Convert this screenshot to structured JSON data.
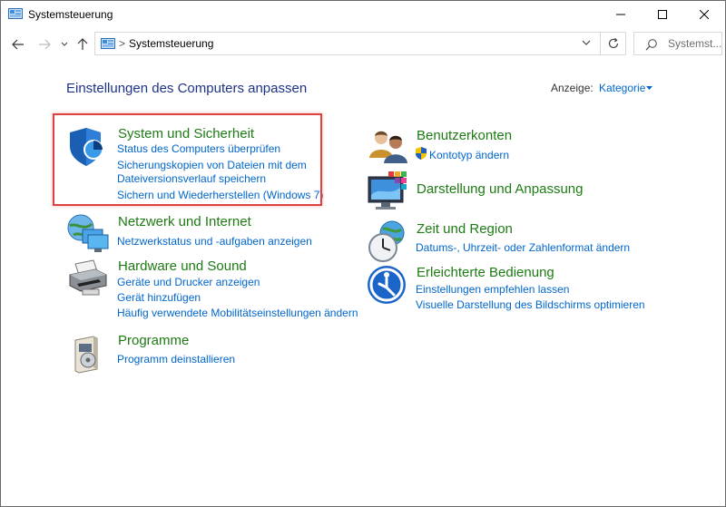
{
  "window": {
    "title": "Systemsteuerung"
  },
  "address": {
    "path": "Systemsteuerung",
    "separator": ">"
  },
  "search": {
    "placeholder": "Systemst..."
  },
  "header": {
    "heading": "Einstellungen des Computers anpassen",
    "view_label": "Anzeige:",
    "view_value": "Kategorie"
  },
  "categories": [
    {
      "title": "System und Sicherheit",
      "icon": "shield-icon",
      "links": [
        "Status des Computers überprüfen",
        "Sicherungskopien von Dateien mit dem",
        "Dateiversionsverlauf speichern",
        "Sichern und Wiederherstellen (Windows 7)"
      ]
    },
    {
      "title": "Netzwerk und Internet",
      "icon": "network-globe-icon",
      "links": [
        "Netzwerkstatus und -aufgaben anzeigen"
      ]
    },
    {
      "title": "Hardware und Sound",
      "icon": "printer-icon",
      "links": [
        "Geräte und Drucker anzeigen",
        "Gerät hinzufügen",
        "Häufig verwendete Mobilitätseinstellungen ändern"
      ]
    },
    {
      "title": "Programme",
      "icon": "programs-box-icon",
      "links": [
        "Programm deinstallieren"
      ]
    },
    {
      "title": "Benutzerkonten",
      "icon": "users-icon",
      "links": [
        "Kontotyp ändern"
      ]
    },
    {
      "title": "Darstellung und Anpassung",
      "icon": "monitor-color-icon",
      "links": []
    },
    {
      "title": "Zeit und Region",
      "icon": "clock-globe-icon",
      "links": [
        "Datums-, Uhrzeit- oder Zahlenformat ändern"
      ]
    },
    {
      "title": "Erleichterte Bedienung",
      "icon": "ease-of-access-icon",
      "links": [
        "Einstellungen empfehlen lassen",
        "Visuelle Darstellung des Bildschirms optimieren"
      ]
    }
  ],
  "colors": {
    "heading": "#1e3287",
    "category_title": "#1e7b14",
    "link": "#0066cc",
    "highlight": "#e04040"
  }
}
